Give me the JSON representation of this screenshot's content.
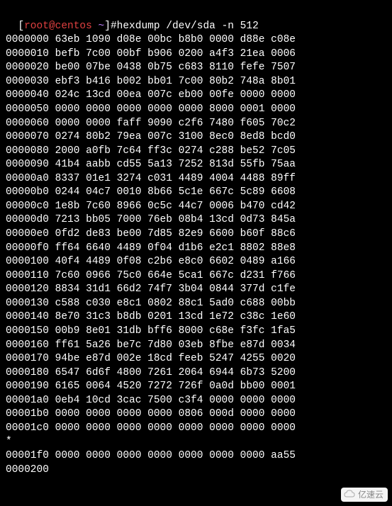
{
  "prompt": {
    "open_bracket": "[",
    "userhost": "root@centos",
    "space": " ",
    "tilde": "~",
    "close_bracket": "]",
    "hash": "#",
    "command": "hexdump /dev/sda -n 512"
  },
  "hex_lines": [
    "0000000 63eb 1090 d08e 00bc b8b0 0000 d88e c08e",
    "0000010 befb 7c00 00bf b906 0200 a4f3 21ea 0006",
    "0000020 be00 07be 0438 0b75 c683 8110 fefe 7507",
    "0000030 ebf3 b416 b002 bb01 7c00 80b2 748a 8b01",
    "0000040 024c 13cd 00ea 007c eb00 00fe 0000 0000",
    "0000050 0000 0000 0000 0000 0000 8000 0001 0000",
    "0000060 0000 0000 faff 9090 c2f6 7480 f605 70c2",
    "0000070 0274 80b2 79ea 007c 3100 8ec0 8ed8 bcd0",
    "0000080 2000 a0fb 7c64 ff3c 0274 c288 be52 7c05",
    "0000090 41b4 aabb cd55 5a13 7252 813d 55fb 75aa",
    "00000a0 8337 01e1 3274 c031 4489 4004 4488 89ff",
    "00000b0 0244 04c7 0010 8b66 5c1e 667c 5c89 6608",
    "00000c0 1e8b 7c60 8966 0c5c 44c7 0006 b470 cd42",
    "00000d0 7213 bb05 7000 76eb 08b4 13cd 0d73 845a",
    "00000e0 0fd2 de83 be00 7d85 82e9 6600 b60f 88c6",
    "00000f0 ff64 6640 4489 0f04 d1b6 e2c1 8802 88e8",
    "0000100 40f4 4489 0f08 c2b6 e8c0 6602 0489 a166",
    "0000110 7c60 0966 75c0 664e 5ca1 667c d231 f766",
    "0000120 8834 31d1 66d2 74f7 3b04 0844 377d c1fe",
    "0000130 c588 c030 e8c1 0802 88c1 5ad0 c688 00bb",
    "0000140 8e70 31c3 b8db 0201 13cd 1e72 c38c 1e60",
    "0000150 00b9 8e01 31db bff6 8000 c68e f3fc 1fa5",
    "0000160 ff61 5a26 be7c 7d80 03eb 8fbe e87d 0034",
    "0000170 94be e87d 002e 18cd feeb 5247 4255 0020",
    "0000180 6547 6d6f 4800 7261 2064 6944 6b73 5200",
    "0000190 6165 0064 4520 7272 726f 0a0d bb00 0001",
    "00001a0 0eb4 10cd 3cac 7500 c3f4 0000 0000 0000",
    "00001b0 0000 0000 0000 0000 0806 000d 0000 0000",
    "00001c0 0000 0000 0000 0000 0000 0000 0000 0000",
    "*",
    "00001f0 0000 0000 0000 0000 0000 0000 0000 aa55",
    "0000200"
  ],
  "watermark": "亿速云"
}
